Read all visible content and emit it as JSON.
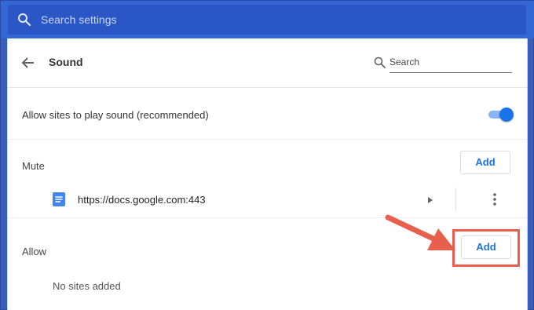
{
  "topbar": {
    "search_placeholder": "Search settings",
    "icon": "search-icon"
  },
  "header": {
    "title": "Sound",
    "back_icon": "arrow-back-icon",
    "search_label": "Search",
    "search_icon": "search-icon"
  },
  "sound_toggle": {
    "label": "Allow sites to play sound (recommended)",
    "enabled": true
  },
  "mute": {
    "title": "Mute",
    "add_label": "Add",
    "sites": [
      {
        "url": "https://docs.google.com:443",
        "icon": "docs-icon"
      }
    ]
  },
  "allow": {
    "title": "Allow",
    "add_label": "Add",
    "empty_text": "No sites added"
  },
  "colors": {
    "accent": "#1a73e8",
    "topbar": "#3367d6",
    "highlight": "#e8604c"
  }
}
